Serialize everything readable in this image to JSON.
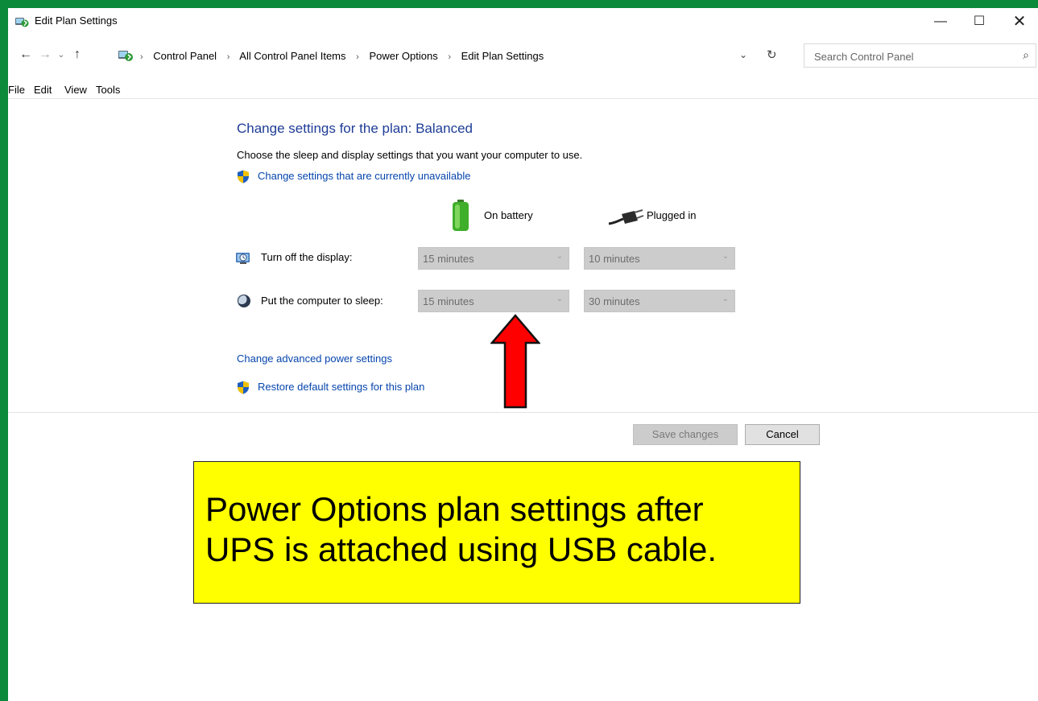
{
  "window": {
    "title": "Edit Plan Settings",
    "controls": {
      "minimize": "—",
      "maximize": "☐",
      "close": "✕"
    }
  },
  "address": {
    "nav": {
      "back": "←",
      "forward": "→",
      "recent": "⌄",
      "up": "↑"
    },
    "breadcrumbs": [
      "Control Panel",
      "All Control Panel Items",
      "Power Options",
      "Edit Plan Settings"
    ],
    "separator": "›",
    "dropdown": "⌄",
    "refresh": "↻",
    "search_placeholder": "Search Control Panel",
    "search_icon": "⌕"
  },
  "menu": {
    "file": "File",
    "edit": "Edit",
    "view": "View",
    "tools": "Tools"
  },
  "plan": {
    "heading": "Change settings for the plan: Balanced",
    "description": "Choose the sleep and display settings that you want your computer to use.",
    "unavailable_link": "Change settings that are currently unavailable",
    "col_battery": "On battery",
    "col_plugged": "Plugged in",
    "display_label": "Turn off the display:",
    "sleep_label": "Put the computer to sleep:",
    "display_battery": "15 minutes",
    "display_plugged": "10 minutes",
    "sleep_battery": "15 minutes",
    "sleep_plugged": "30 minutes",
    "chevron": "⌄",
    "advanced_link": "Change advanced power settings",
    "restore_link": "Restore default settings for this plan"
  },
  "buttons": {
    "save": "Save changes",
    "cancel": "Cancel"
  },
  "callout": {
    "line1": "Power Options plan settings after",
    "line2": "UPS is attached using USB cable."
  },
  "colors": {
    "frame": "#0a8a3a",
    "heading": "#1e3c96",
    "link": "#0645ad",
    "callout": "#ffff00",
    "arrow": "#ff0000"
  },
  "icons": {
    "title": "power-options-icon",
    "breadcrumb": "power-options-icon",
    "shield": "uac-shield-icon",
    "battery": "battery-icon",
    "plug": "plug-icon",
    "display": "display-timer-icon",
    "sleep": "sleep-moon-icon",
    "arrow": "red-up-arrow-icon"
  }
}
